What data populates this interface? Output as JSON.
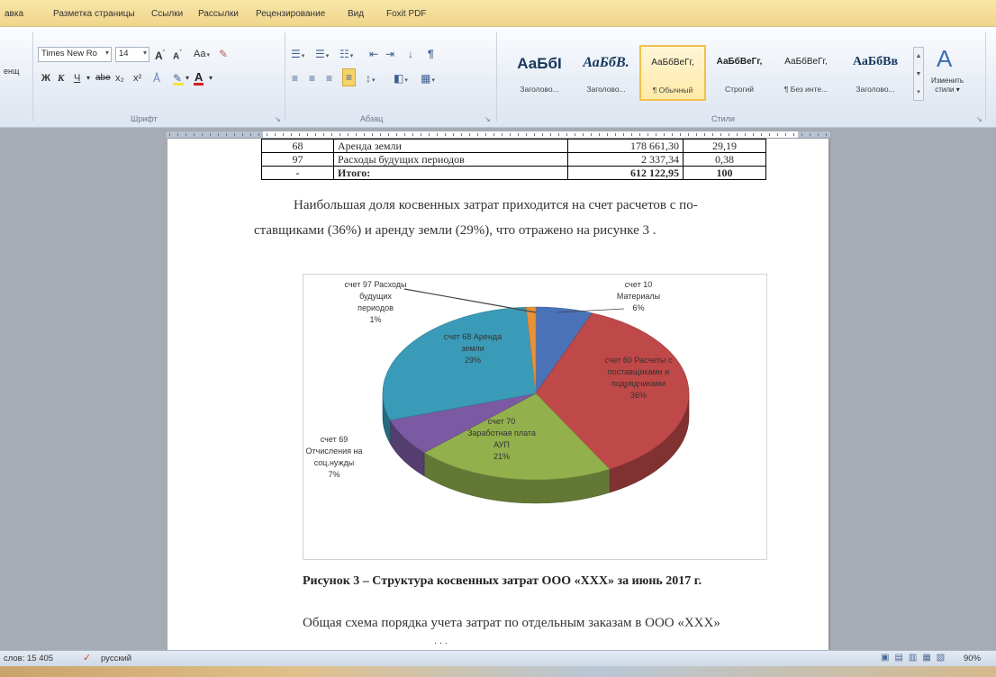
{
  "ribbon": {
    "tabs": [
      "авка",
      "Разметка страницы",
      "Ссылки",
      "Рассылки",
      "Рецензирование",
      "Вид",
      "Foxit PDF"
    ],
    "font_name": "Times New Ro",
    "font_size": "14",
    "left_stub": "енщ",
    "format_buttons": [
      "Ж",
      "К",
      "Ч",
      "abe",
      "x₂",
      "x²"
    ],
    "group_labels": {
      "font": "Шрифт",
      "paragraph": "Абзац",
      "styles": "Стили"
    },
    "styles": [
      {
        "sample": "АаБбІ",
        "name": "Заголово..."
      },
      {
        "sample": "АаБбВ.",
        "name": "Заголово..."
      },
      {
        "sample": "АаБбВеГг,",
        "name": "¶ Обычный"
      },
      {
        "sample": "АаБбВеГг,",
        "name": "Строгий"
      },
      {
        "sample": "АаБбВеГг,",
        "name": "¶ Без инте..."
      },
      {
        "sample": "АаБбВв",
        "name": "Заголово..."
      }
    ],
    "change_styles_label": "Изменить стили ▾",
    "colors": {
      "highlight": "#f3e33a",
      "font_color": "#d12020"
    }
  },
  "document": {
    "table_rows": [
      {
        "account": "68",
        "name": "Аренда земли",
        "amount": "178 661,30",
        "share": "29,19",
        "bold": false
      },
      {
        "account": "97",
        "name": "Расходы будущих периодов",
        "amount": "2 337,34",
        "share": "0,38",
        "bold": false
      },
      {
        "account": "-",
        "name": "Итого:",
        "amount": "612 122,95",
        "share": "100",
        "bold": true
      }
    ],
    "paragraph_line1": "Наибольшая доля косвенных затрат приходится на счет расчетов с по-",
    "paragraph_line2": "ставщиками (36%) и аренду земли (29%), что отражено на рисунке 3 .",
    "caption": "Рисунок 3 – Структура косвенных затрат ООО «ХХХ» за июнь 2017 г.",
    "next_paragraph": "Общая схема порядка учета затрат по отдельным заказам в ООО «ХХХ»"
  },
  "chart_data": {
    "type": "pie",
    "style": "3d",
    "slices": [
      {
        "label": "счет 10 Материалы 6%",
        "value": 6,
        "color": "#4a72b8"
      },
      {
        "label": "счет 60 Расчеты с поставщиками и подрядчиками 36%",
        "value": 36,
        "color": "#bf4848"
      },
      {
        "label": "счет 70 Заработная плата АУП 21%",
        "value": 21,
        "color": "#92b04c"
      },
      {
        "label": "счет 69 Отчисления на соц.нужды 7%",
        "value": 7,
        "color": "#7c5aa3"
      },
      {
        "label": "счет 68 Аренда земли 29%",
        "value": 29,
        "color": "#3a9bb8"
      },
      {
        "label": "счет 97 Расходы будущих периодов 1%",
        "value": 1,
        "color": "#e8913a"
      }
    ],
    "label_lines": {
      "s10": [
        "счет 10",
        "Материалы",
        "6%"
      ],
      "s60": [
        "счет 60 Расчеты с",
        "поставщиками и",
        "подрядчиками",
        "36%"
      ],
      "s70": [
        "счет 70",
        "Заработная плата",
        "АУП",
        "21%"
      ],
      "s69": [
        "счет 69",
        "Отчисления на",
        "соц.нужды",
        "7%"
      ],
      "s68": [
        "счет 68 Аренда",
        "земли",
        "29%"
      ],
      "s97": [
        "счет 97 Расходы",
        "будущих",
        "периодов",
        "1%"
      ]
    }
  },
  "status": {
    "words": "слов: 15 405",
    "language": "русский",
    "zoom": "90%"
  }
}
